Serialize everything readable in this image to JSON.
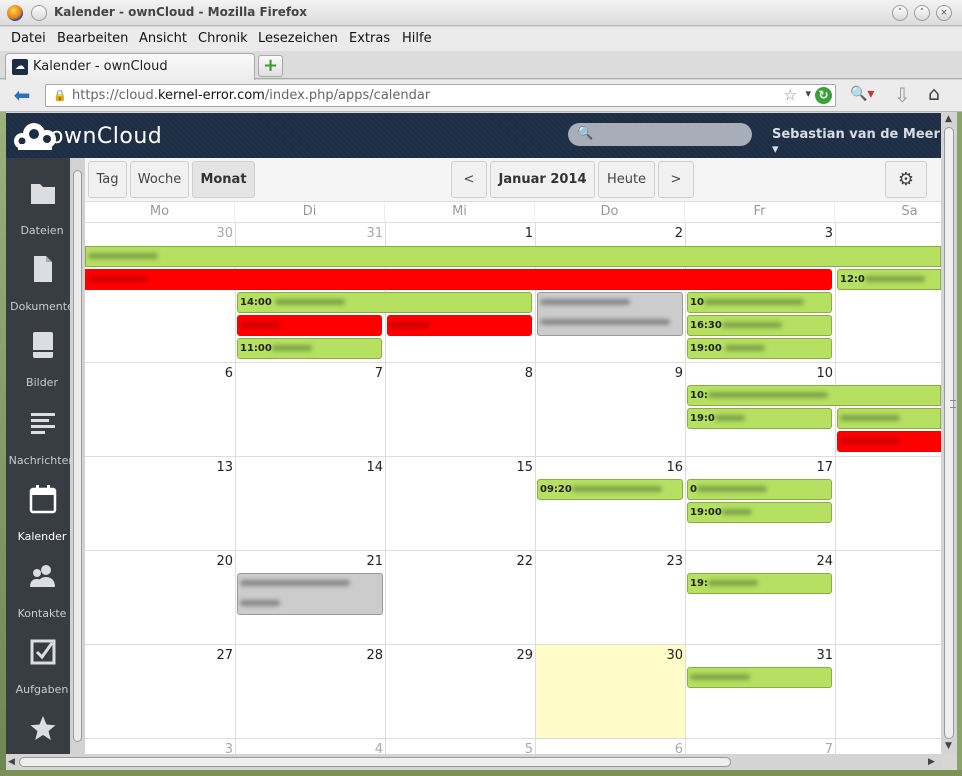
{
  "window": {
    "title": "Kalender - ownCloud - Mozilla Firefox"
  },
  "menu": [
    "Datei",
    "Bearbeiten",
    "Ansicht",
    "Chronik",
    "Lesezeichen",
    "Extras",
    "Hilfe"
  ],
  "tab": {
    "label": "Kalender - ownCloud",
    "newtab": "+"
  },
  "address": {
    "prefix": "https://cloud.",
    "domain": "kernel-error.com",
    "path": "/index.php/apps/calendar"
  },
  "header": {
    "logo": "ownCloud",
    "search_placeholder": "",
    "user": "Sebastian van de Meer ▾"
  },
  "sidebar": [
    {
      "label": "Dateien",
      "icon": "folder-icon"
    },
    {
      "label": "Dokumente",
      "icon": "document-icon"
    },
    {
      "label": "Bilder",
      "icon": "pictures-icon"
    },
    {
      "label": "Nachrichten",
      "icon": "news-icon"
    },
    {
      "label": "Kalender",
      "icon": "calendar-icon",
      "active": true
    },
    {
      "label": "Kontakte",
      "icon": "contacts-icon"
    },
    {
      "label": "Aufgaben",
      "icon": "tasks-icon"
    },
    {
      "label": "",
      "icon": "star-icon"
    }
  ],
  "toolbar": {
    "day": "Tag",
    "week": "Woche",
    "month": "Monat",
    "prev": "<",
    "current": "Januar 2014",
    "today": "Heute",
    "next": ">"
  },
  "weekdays": [
    "Mo",
    "Di",
    "Mi",
    "Do",
    "Fr",
    "Sa"
  ],
  "weeks": [
    [
      "30",
      "31",
      "1",
      "2",
      "3",
      ""
    ],
    [
      "6",
      "7",
      "8",
      "9",
      "10",
      ""
    ],
    [
      "13",
      "14",
      "15",
      "16",
      "17",
      ""
    ],
    [
      "20",
      "21",
      "22",
      "23",
      "24",
      ""
    ],
    [
      "27",
      "28",
      "29",
      "30",
      "31",
      ""
    ],
    [
      "3",
      "4",
      "5",
      "6",
      "7",
      ""
    ]
  ],
  "events": {
    "e1": "",
    "e2": "",
    "e3": "12:0",
    "e4": "14:00",
    "e5": "",
    "e6": "10",
    "e7": "",
    "e8": "",
    "e9": "16:30",
    "e10": "11:00",
    "e11": "19:00",
    "e12": "10:",
    "e13": "19:0",
    "e14": "",
    "e15": "",
    "e16": "09:20",
    "e17": "0",
    "e18": "19:00",
    "e19": "",
    "e20": "19:",
    "e21": ""
  }
}
